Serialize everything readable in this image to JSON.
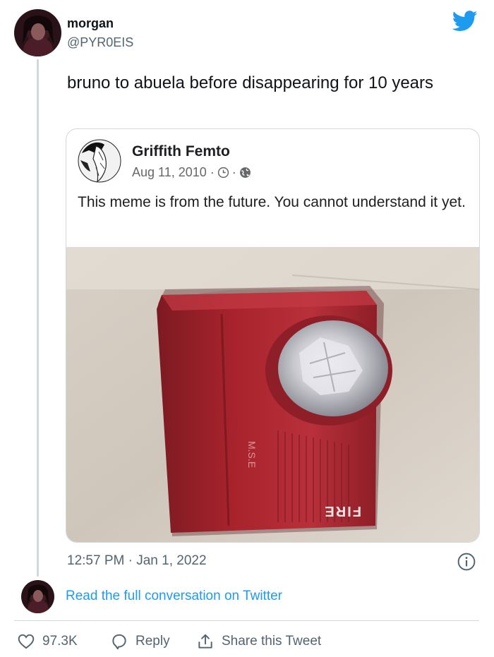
{
  "tweet": {
    "author_name": "morgan",
    "author_handle": "@PYR0EIS",
    "text": "bruno to abuela before disappearing for 10 years",
    "timestamp": "12:57 PM · Jan 1, 2022"
  },
  "quoted_post": {
    "author_name": "Griffith Femto",
    "date": "Aug 11, 2010 · ",
    "text": "This meme is from the future. You cannot understand it yet.",
    "image_label": "FIRE"
  },
  "footer": {
    "read_link": "Read the full conversation on Twitter",
    "like_count": "97.3K",
    "reply_label": "Reply",
    "share_label": "Share this Tweet"
  },
  "colors": {
    "twitter_blue": "#1d9bf0",
    "text_secondary": "#536471",
    "border": "#cfd9de",
    "alarm_red": "#a8232c"
  },
  "icons": [
    "twitter-bird-icon",
    "clock-icon",
    "globe-icon",
    "info-icon",
    "heart-icon",
    "reply-icon",
    "share-icon"
  ]
}
